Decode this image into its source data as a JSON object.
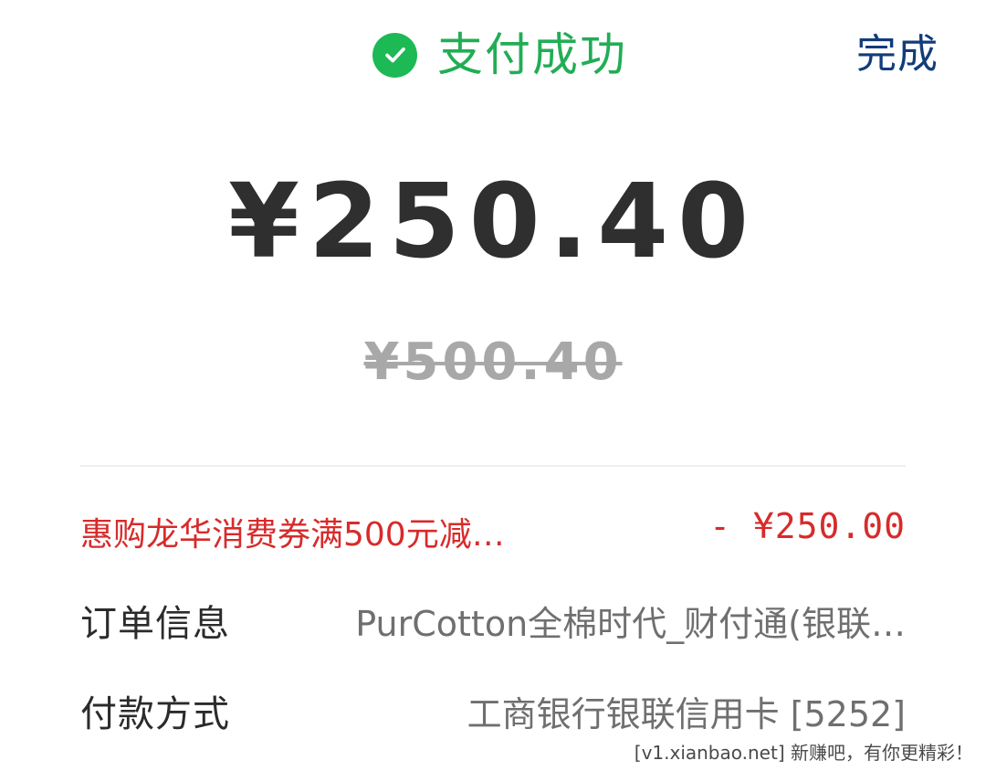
{
  "header": {
    "status_text": "支付成功",
    "status_icon": "check-circle-icon",
    "done_label": "完成"
  },
  "payment": {
    "amount": "¥250.40",
    "original_amount": "¥500.40"
  },
  "details": {
    "coupon": {
      "label": "惠购龙华消费券满500元减…",
      "value": "- ¥250.00"
    },
    "order_info": {
      "label": "订单信息",
      "value": "PurCotton全棉时代_财付通(银联…"
    },
    "payment_method": {
      "label": "付款方式",
      "value": "工商银行银联信用卡 [5252]"
    }
  },
  "watermark": "[v1.xianbao.net] 新赚吧，有你更精彩！",
  "colors": {
    "success": "#1db954",
    "coupon": "#d72b2b",
    "done": "#123c7a"
  }
}
